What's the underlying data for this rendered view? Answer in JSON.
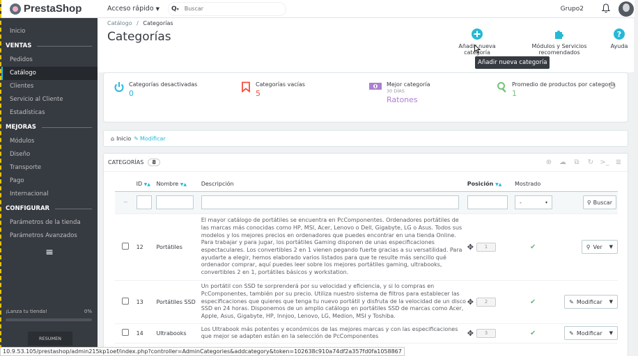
{
  "app": {
    "logo_text": "PrestaShop"
  },
  "topbar": {
    "quick_access": "Acceso rápido",
    "search_placeholder": "Buscar",
    "employee": "Grupo2"
  },
  "sidebar": {
    "home": "Inicio",
    "sections": [
      {
        "title": "VENTAS",
        "items": [
          "Pedidos",
          "Catálogo",
          "Clientes",
          "Servicio al Cliente",
          "Estadísticas"
        ]
      },
      {
        "title": "MEJORAS",
        "items": [
          "Módulos",
          "Diseño",
          "Transporte",
          "Pago",
          "Internacional"
        ]
      },
      {
        "title": "CONFIGURAR",
        "items": [
          "Parámetros de la tienda",
          "Parámetros Avanzados"
        ]
      }
    ],
    "active": "Catálogo",
    "launch_label": "¡Lanza tu tienda!",
    "launch_pct": "0%",
    "launch_progress": 0,
    "resume": "RESUMEN"
  },
  "header": {
    "breadcrumb_parent": "Catálogo",
    "breadcrumb_sep": "/",
    "breadcrumb_current": "Categorías",
    "title": "Categorías",
    "toolbar": {
      "add": "Añadir nueva categoría",
      "modules": "Módulos y Servicios recomendados",
      "help": "Ayuda"
    },
    "tooltip": "Añadir nueva categoría"
  },
  "kpis": [
    {
      "label": "Categorías desactivadas",
      "value": "0",
      "color": "#25b9d7"
    },
    {
      "label": "Categorías vacías",
      "value": "5",
      "color": "#f54c3e"
    },
    {
      "label": "Mejor categoría",
      "sub": "30 DÍAS",
      "value": "Ratones",
      "color": "#ab7fd1"
    },
    {
      "label": "Promedio de productos por categoría",
      "value": "1",
      "color": "#72c279"
    }
  ],
  "filterbar": {
    "home": "Inicio",
    "modify": "Modificar"
  },
  "panel": {
    "title": "CATEGORÍAS",
    "count": "8",
    "columns": {
      "id": "ID",
      "name": "Nombre",
      "description": "Descripción",
      "position": "Posición",
      "shown": "Mostrado"
    },
    "filter_dashes": "--",
    "shown_select": "-",
    "search_button": "Buscar",
    "rows": [
      {
        "id": "12",
        "name": "Portátiles",
        "description": "El mayor catálogo de portátiles se encuentra en PcComponentes. Ordenadores portátiles de las marcas más conocidas como HP, MSI, Acer, Lenovo o Dell, Gigabyte, LG o Asus. Todos sus modelos y los mejores precios en ordenadores que puedes encontrar en una tienda Online. Para trabajar y para jugar, los portátiles Gaming disponen de unas especificaciones espectaculares. Los convertibles 2 en 1 vienen pegando fuerte gracias a su versatilidad. Para ayudarte a elegir, hemos elaborado varios listados para que te resulte más sencillo qué ordenador comprar, aquí puedes leer sobre los mejores portátiles gaming, ultrabooks, convertibles 2 en 1, portátiles básicos y workstation.",
        "position": "1",
        "action": "Ver"
      },
      {
        "id": "13",
        "name": "Portátiles SSD",
        "description": "Un portátil con SSD te sorprenderá por su velocidad y eficiencia, y si lo compras en PcComponentes, también por su precio. Utiliza nuestro sistema de filtros para establecer las especificaciones que quieres que tenga tu nuevo portátil y disfruta de la velocidad de un disco SSD en 24 horas. Disponemos de un amplio catálogo en portátiles SSD de marcas como Acer, Apple, Asus, Gigabyte, HP, Innjoo, Lenovo, LG, Medion, MSI y Toshiba.",
        "position": "2",
        "action": "Modificar"
      },
      {
        "id": "14",
        "name": "Ultrabooks",
        "description": "Los Ultrabook más potentes y económicos de las mejores marcas y con las especificaciones que mejor se adapten están en la selección de PcComponentes",
        "position": "3",
        "action": "Modificar"
      }
    ]
  },
  "statusbar": "10.9.53.105/prestashop/admin215kp1oef/index.php?controller=AdminCategories&addcategory&token=102638c910a74df2a357fd0fa1058867"
}
